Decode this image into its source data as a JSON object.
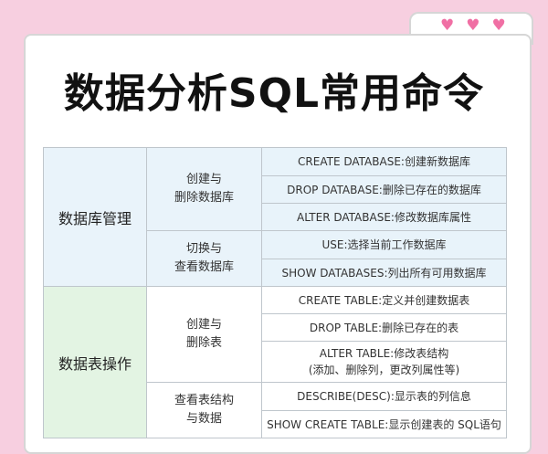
{
  "title": "数据分析SQL常用命令",
  "groups": [
    {
      "category": "数据库管理",
      "subgroups": [
        {
          "label_lines": [
            "创建与",
            "删除数据库"
          ],
          "commands": [
            "CREATE DATABASE:创建新数据库",
            "DROP DATABASE:删除已存在的数据库",
            "ALTER DATABASE:修改数据库属性"
          ]
        },
        {
          "label_lines": [
            "切换与",
            "查看数据库"
          ],
          "commands": [
            "USE:选择当前工作数据库",
            "SHOW DATABASES:列出所有可用数据库"
          ]
        }
      ]
    },
    {
      "category": "数据表操作",
      "subgroups": [
        {
          "label_lines": [
            "创建与",
            "删除表"
          ],
          "commands": [
            "CREATE TABLE:定义并创建数据表",
            "DROP TABLE:删除已存在的表",
            "ALTER TABLE:修改表结构\n(添加、删除列，更改列属性等)"
          ]
        },
        {
          "label_lines": [
            "查看表结构",
            "与数据"
          ],
          "commands": [
            "DESCRIBE(DESC):显示表的列信息",
            "SHOW CREATE TABLE:显示创建表的 SQL语句"
          ]
        }
      ]
    }
  ],
  "colors": {
    "background": "#f7cfe0",
    "heart": "#f06fa4",
    "group1_fill": "#e9f3fa",
    "group2_cat_fill": "#e3f4e3"
  }
}
